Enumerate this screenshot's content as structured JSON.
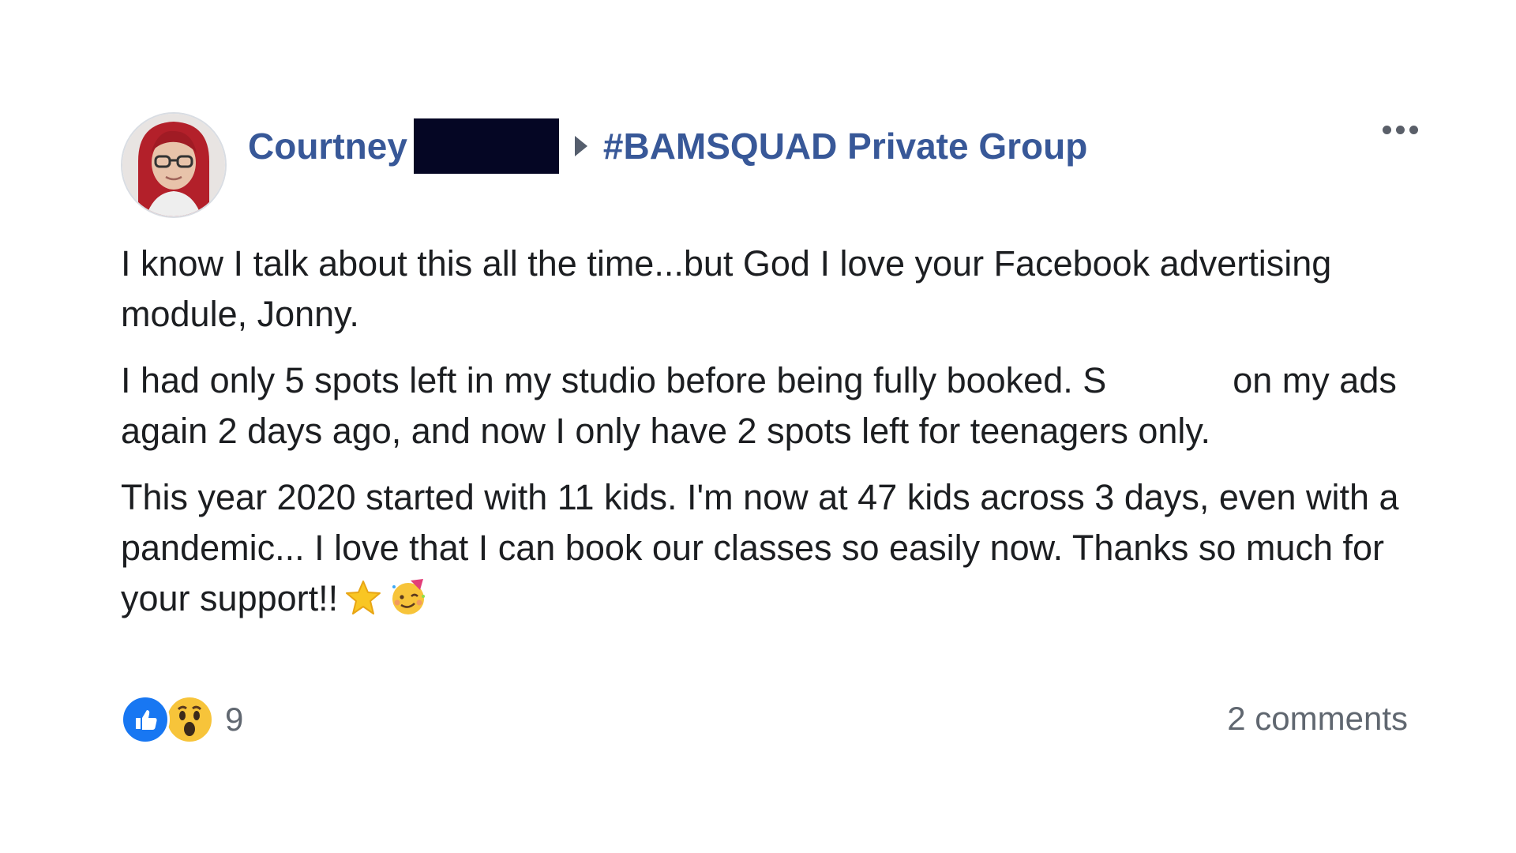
{
  "post": {
    "author": "Courtney",
    "group": "#BAMSQUAD Private Group",
    "paragraphs": {
      "p1": "I know I talk about this all the time...but God I love your Facebook advertising module, Jonny.",
      "p2_before_gap": "I had only 5 spots left in my studio before being fully booked. S",
      "p2_after_gap": "on my ads again 2 days ago, and now I only have 2 spots left for teenagers only.",
      "p3": "This year 2020 started with 11 kids. I'm now at 47 kids across 3 days, even with a pandemic... I love that I can book our classes so easily now. Thanks so much for your support!!"
    },
    "emojis": [
      "star-emoji",
      "party-face-emoji"
    ],
    "reactions": {
      "types": [
        "like",
        "wow"
      ],
      "count": "9"
    },
    "comments": "2 comments"
  },
  "colors": {
    "link": "#385898",
    "text": "#1c1e21",
    "muted": "#606770",
    "like": "#1877f2",
    "wow": "#f7c43a",
    "redaction": "#050624"
  }
}
